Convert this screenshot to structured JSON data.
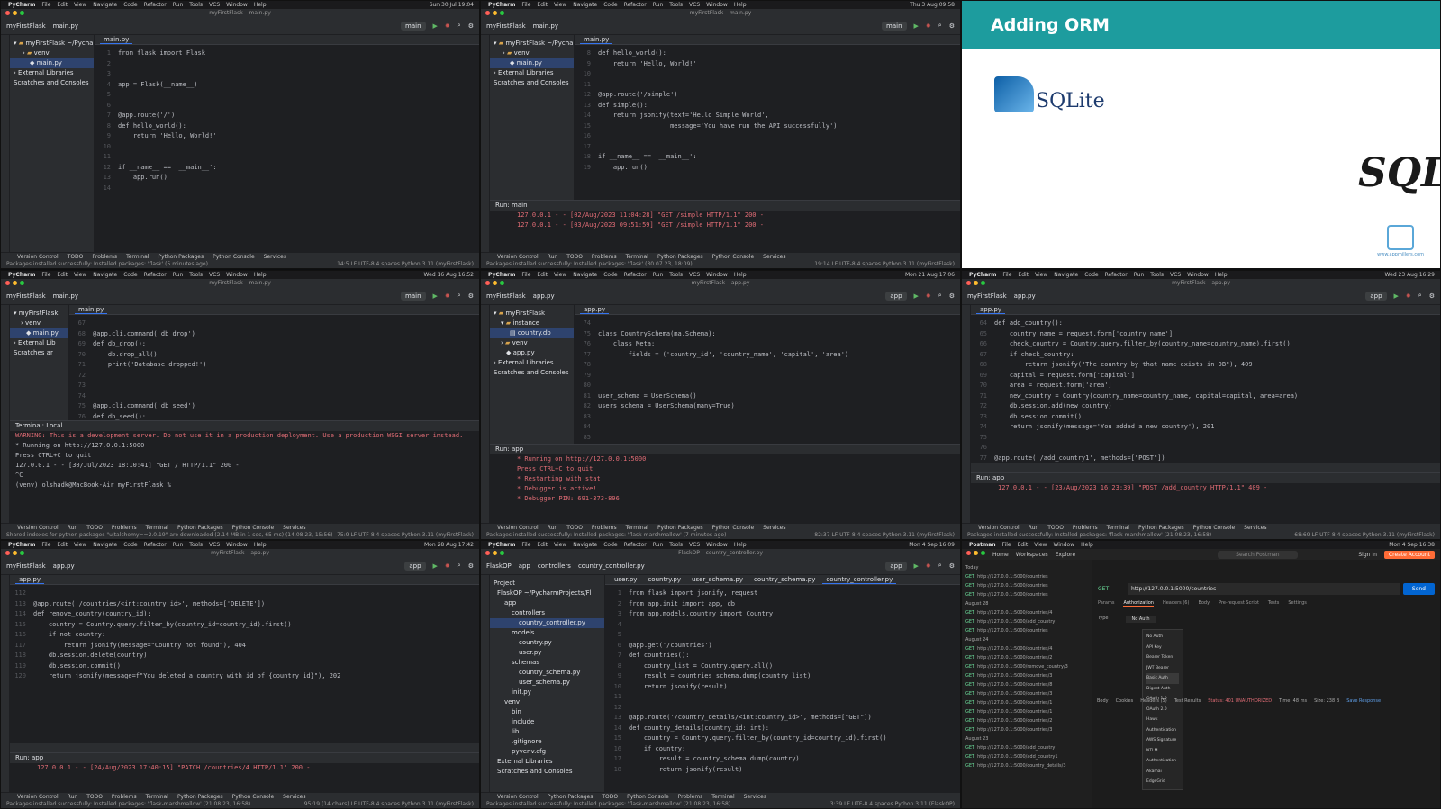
{
  "menubar": [
    "File",
    "Edit",
    "View",
    "Navigate",
    "Code",
    "Refactor",
    "Run",
    "Tools",
    "VCS",
    "Window",
    "Help"
  ],
  "panes": {
    "p1": {
      "app": "PyCharm",
      "clock": "Sun 30 Jul 19:04",
      "window_title": "myFirstFlask – main.py",
      "project": "myFirstFlask",
      "file": "main.py",
      "branch": "main",
      "tree": [
        "myFirstFlask ~/PycharmProjects",
        "venv",
        "main.py",
        "External Libraries",
        "Scratches and Consoles"
      ],
      "code": [
        {
          "n": "1",
          "t": "from flask import Flask"
        },
        {
          "n": "2",
          "t": ""
        },
        {
          "n": "3",
          "t": ""
        },
        {
          "n": "4",
          "t": "app = Flask(__name__)"
        },
        {
          "n": "5",
          "t": ""
        },
        {
          "n": "6",
          "t": ""
        },
        {
          "n": "7",
          "t": "@app.route('/')"
        },
        {
          "n": "8",
          "t": "def hello_world():"
        },
        {
          "n": "9",
          "t": "    return 'Hello, World!'"
        },
        {
          "n": "10",
          "t": ""
        },
        {
          "n": "11",
          "t": ""
        },
        {
          "n": "12",
          "t": "if __name__ == '__main__':"
        },
        {
          "n": "13",
          "t": "    app.run()"
        },
        {
          "n": "14",
          "t": "    "
        }
      ],
      "tools": [
        "Version Control",
        "TODO",
        "Problems",
        "Terminal",
        "Python Packages",
        "Python Console",
        "Services"
      ],
      "status": "Packages installed successfully: Installed packages: 'flask' (5 minutes ago)",
      "status_r": "14:5  LF  UTF-8  4 spaces  Python 3.11 (myFirstFlask)"
    },
    "p2": {
      "app": "PyCharm",
      "clock": "Thu 3 Aug 09:58",
      "window_title": "myFirstFlask – main.py",
      "project": "myFirstFlask",
      "file": "main.py",
      "branch": "main",
      "tree": [
        "myFirstFlask ~/PycharmProjects",
        "venv",
        "main.py",
        "External Libraries",
        "Scratches and Consoles"
      ],
      "code": [
        {
          "n": "8",
          "t": "def hello_world():"
        },
        {
          "n": "9",
          "t": "    return 'Hello, World!'"
        },
        {
          "n": "10",
          "t": ""
        },
        {
          "n": "11",
          "t": ""
        },
        {
          "n": "12",
          "t": "@app.route('/simple')"
        },
        {
          "n": "13",
          "t": "def simple():"
        },
        {
          "n": "14",
          "t": "    return jsonify(text='Hello Simple World',"
        },
        {
          "n": "15",
          "t": "                   message='You have run the API successfully')"
        },
        {
          "n": "16",
          "t": ""
        },
        {
          "n": "17",
          "t": ""
        },
        {
          "n": "18",
          "t": "if __name__ == '__main__':"
        },
        {
          "n": "19",
          "t": "    app.run()"
        }
      ],
      "crumb": "if __name__ == '__main__'",
      "run_label": "Run:",
      "run_tab": "main",
      "run_lines": [
        "127.0.0.1 - - [02/Aug/2023 11:04:28] \"GET /simple HTTP/1.1\" 200 -",
        "127.0.0.1 - - [03/Aug/2023 09:51:59] \"GET /simple HTTP/1.1\" 200 -"
      ],
      "tools": [
        "Version Control",
        "Run",
        "TODO",
        "Problems",
        "Terminal",
        "Python Packages",
        "Python Console",
        "Services"
      ],
      "status": "Packages installed successfully: Installed packages: 'flask' (30.07.23, 18:09)",
      "status_r": "19:14  LF  UTF-8  4 spaces  Python 3.11 (myFirstFlask)"
    },
    "p3": {
      "title": "Adding ORM",
      "logo_text": "SQLite",
      "big_text": "SQL",
      "footer": "www.appmillers.com"
    },
    "p4": {
      "app": "PyCharm",
      "clock": "Wed 16 Aug 16:52",
      "window_title": "myFirstFlask – main.py",
      "project": "myFirstFlask",
      "file": "main.py",
      "branch": "main",
      "tree": [
        "myFirstFlask",
        "venv",
        "main.py",
        "External Lib",
        "Scratches ar"
      ],
      "code": [
        {
          "n": "67",
          "t": ""
        },
        {
          "n": "68",
          "t": "@app.cli.command('db_drop')"
        },
        {
          "n": "69",
          "t": "def db_drop():"
        },
        {
          "n": "70",
          "t": "    db.drop_all()"
        },
        {
          "n": "71",
          "t": "    print('Database dropped!')"
        },
        {
          "n": "72",
          "t": ""
        },
        {
          "n": "73",
          "t": ""
        },
        {
          "n": "74",
          "t": ""
        },
        {
          "n": "75",
          "t": "@app.cli.command('db_seed')"
        },
        {
          "n": "76",
          "t": "def db_seed():"
        }
      ],
      "crumb": "db_seed()",
      "term_label": "Terminal:",
      "term_tab": "Local",
      "term_lines": [
        "WARNING: This is a development server. Do not use it in a production deployment. Use a production WSGI server instead.",
        "* Running on http://127.0.0.1:5000",
        "Press CTRL+C to quit",
        "127.0.0.1 - - [30/Jul/2023 18:10:41] \"GET / HTTP/1.1\" 200 -",
        "^C",
        "(venv) olshadk@MacBook-Air myFirstFlask % "
      ],
      "tools": [
        "Version Control",
        "Run",
        "TODO",
        "Problems",
        "Terminal",
        "Python Packages",
        "Python Console",
        "Services"
      ],
      "status": "Shared indexes for python packages \"ujtalchemy==2.0.19\" are downloaded (2.14 MB in 1 sec, 65 ms) (14.08.23, 15:56)",
      "status_r": "75:9  LF  UTF-8  4 spaces  Python 3.11 (myFirstFlask)"
    },
    "p5": {
      "app": "PyCharm",
      "clock": "Mon 21 Aug 17:06",
      "window_title": "myFirstFlask – app.py",
      "project": "myFirstFlask",
      "file": "app.py",
      "branch": "app",
      "tree": [
        "myFirstFlask",
        "instance",
        "country.db",
        "venv",
        "app.py",
        "External Libraries",
        "Scratches and Consoles"
      ],
      "code": [
        {
          "n": "74",
          "t": ""
        },
        {
          "n": "75",
          "t": "class CountrySchema(ma.Schema):"
        },
        {
          "n": "76",
          "t": "    class Meta:"
        },
        {
          "n": "77",
          "t": "        fields = ('country_id', 'country_name', 'capital', 'area')"
        },
        {
          "n": "78",
          "t": ""
        },
        {
          "n": "79",
          "t": ""
        },
        {
          "n": "80",
          "t": ""
        },
        {
          "n": "81",
          "t": "user_schema = UserSchema()"
        },
        {
          "n": "82",
          "t": "users_schema = UserSchema(many=True)"
        },
        {
          "n": "83",
          "t": ""
        },
        {
          "n": "84",
          "t": ""
        },
        {
          "n": "85",
          "t": ""
        },
        {
          "n": "86",
          "t": "@app.cli.command('db_create')"
        }
      ],
      "run_label": "Run:",
      "run_tab": "app",
      "run_lines": [
        "* Running on http://127.0.0.1:5000",
        "Press CTRL+C to quit",
        "* Restarting with stat",
        "* Debugger is active!",
        "* Debugger PIN: 691-373-896"
      ],
      "tools": [
        "Version Control",
        "Run",
        "TODO",
        "Problems",
        "Terminal",
        "Python Packages",
        "Python Console",
        "Services"
      ],
      "status": "Packages installed successfully: Installed packages: 'flask-marshmallow' (7 minutes ago)",
      "status_r": "82:37  LF  UTF-8  4 spaces  Python 3.11 (myFirstFlask)"
    },
    "p6": {
      "app": "PyCharm",
      "clock": "Wed 23 Aug 16:29",
      "window_title": "myFirstFlask – app.py",
      "project": "myFirstFlask",
      "file": "app.py",
      "branch": "app",
      "code": [
        {
          "n": "64",
          "t": "def add_country():"
        },
        {
          "n": "65",
          "t": "    country_name = request.form['country_name']"
        },
        {
          "n": "66",
          "t": "    check_country = Country.query.filter_by(country_name=country_name).first()"
        },
        {
          "n": "67",
          "t": "    if check_country:"
        },
        {
          "n": "68",
          "t": "        return jsonify(\"The country by that name exists in DB\"), 409"
        },
        {
          "n": "69",
          "t": "    capital = request.form['capital']"
        },
        {
          "n": "70",
          "t": "    area = request.form['area']"
        },
        {
          "n": "71",
          "t": "    new_country = Country(country_name=country_name, capital=capital, area=area)"
        },
        {
          "n": "72",
          "t": "    db.session.add(new_country)"
        },
        {
          "n": "73",
          "t": "    db.session.commit()"
        },
        {
          "n": "74",
          "t": "    return jsonify(message='You added a new country'), 201"
        },
        {
          "n": "75",
          "t": ""
        },
        {
          "n": "76",
          "t": ""
        },
        {
          "n": "77",
          "t": "@app.route('/add_country1', methods=[\"POST\"])"
        }
      ],
      "crumb": "add_country()  ›  if check_country",
      "run_label": "Run:",
      "run_tab": "app",
      "run_lines": [
        "127.0.0.1 - - [23/Aug/2023 16:23:39] \"POST /add_country HTTP/1.1\" 409 -"
      ],
      "tools": [
        "Version Control",
        "Run",
        "TODO",
        "Problems",
        "Terminal",
        "Python Packages",
        "Python Console",
        "Services"
      ],
      "status": "Packages installed successfully: Installed packages: 'flask-marshmallow' (21.08.23, 16:58)",
      "status_r": "68:69  LF  UTF-8  4 spaces  Python 3.11 (myFirstFlask)"
    },
    "p7": {
      "app": "PyCharm",
      "clock": "Mon 28 Aug 17:42",
      "window_title": "myFirstFlask – app.py",
      "project": "myFirstFlask",
      "file": "app.py",
      "branch": "app",
      "code": [
        {
          "n": "112",
          "t": ""
        },
        {
          "n": "113",
          "t": "@app.route('/countries/<int:country_id>', methods=['DELETE'])"
        },
        {
          "n": "114",
          "t": "def remove_country(country_id):"
        },
        {
          "n": "115",
          "t": "    country = Country.query.filter_by(country_id=country_id).first()"
        },
        {
          "n": "116",
          "t": "    if not country:"
        },
        {
          "n": "117",
          "t": "        return jsonify(message=\"Country not found\"), 404"
        },
        {
          "n": "118",
          "t": "    db.session.delete(country)"
        },
        {
          "n": "119",
          "t": "    db.session.commit()"
        },
        {
          "n": "120",
          "t": "    return jsonify(message=f\"You deleted a country with id of {country_id}\"), 202"
        }
      ],
      "crumb": "update_country()",
      "run_label": "Run:",
      "run_tab": "app",
      "run_lines": [
        "127.0.0.1 - - [24/Aug/2023 17:40:15] \"PATCH /countries/4 HTTP/1.1\" 200 -"
      ],
      "tools": [
        "Version Control",
        "Run",
        "TODO",
        "Problems",
        "Terminal",
        "Python Packages",
        "Python Console",
        "Services"
      ],
      "status": "Packages installed successfully: Installed packages: 'flask-marshmallow' (21.08.23, 16:58)",
      "status_r": "95:19 (14 chars)  LF  UTF-8  4 spaces  Python 3.11 (myFirstFlask)"
    },
    "p8": {
      "app": "PyCharm",
      "clock": "Mon 4 Sep 16:09",
      "window_title": "FlaskOP – country_controller.py",
      "project": "FlaskOP",
      "crumbs": [
        "app",
        "controllers",
        "country_controller.py"
      ],
      "branch": "app",
      "tabs": [
        "user.py",
        "country.py",
        "user_schema.py",
        "country_schema.py",
        "country_controller.py"
      ],
      "tree": [
        "Project",
        "FlaskOP ~/PycharmProjects/Fl",
        "app",
        "controllers",
        "country_controller.py",
        "models",
        "country.py",
        "user.py",
        "schemas",
        "country_schema.py",
        "user_schema.py",
        "init.py",
        "venv",
        "bin",
        "include",
        "lib",
        ".gitignore",
        "pyvenv.cfg",
        "External Libraries",
        "Scratches and Consoles"
      ],
      "code": [
        {
          "n": "1",
          "t": "from flask import jsonify, request"
        },
        {
          "n": "2",
          "t": "from app.init import app, db"
        },
        {
          "n": "3",
          "t": "from app.models.country import Country"
        },
        {
          "n": "4",
          "t": ""
        },
        {
          "n": "5",
          "t": ""
        },
        {
          "n": "6",
          "t": "@app.get('/countries')"
        },
        {
          "n": "7",
          "t": "def countries():"
        },
        {
          "n": "8",
          "t": "    country_list = Country.query.all()"
        },
        {
          "n": "9",
          "t": "    result = countries_schema.dump(country_list)"
        },
        {
          "n": "10",
          "t": "    return jsonify(result)"
        },
        {
          "n": "11",
          "t": ""
        },
        {
          "n": "12",
          "t": ""
        },
        {
          "n": "13",
          "t": "@app.route('/country_details/<int:country_id>', methods=[\"GET\"])"
        },
        {
          "n": "14",
          "t": "def country_details(country_id: int):"
        },
        {
          "n": "15",
          "t": "    country = Country.query.filter_by(country_id=country_id).first()"
        },
        {
          "n": "16",
          "t": "    if country:"
        },
        {
          "n": "17",
          "t": "        result = country_schema.dump(country)"
        },
        {
          "n": "18",
          "t": "        return jsonify(result)"
        }
      ],
      "tools": [
        "Version Control",
        "Python Packages",
        "TODO",
        "Python Console",
        "Problems",
        "Terminal",
        "Services"
      ],
      "status": "Packages installed successfully: Installed packages: 'flask-marshmallow' (21.08.23, 16:58)",
      "status_r": "3:39  LF  UTF-8  4 spaces  Python 3.11 (FlaskOP)"
    },
    "p9": {
      "app": "Postman",
      "clock": "Mon 4 Sep 16:38",
      "nav": [
        "Home",
        "Workspaces",
        "Explore"
      ],
      "search": "Search Postman",
      "signin": "Sign In",
      "create": "Create Account",
      "history": [
        "Today",
        "http://127.0.0.1:5000/countries",
        "http://127.0.0.1:5000/countries",
        "http://127.0.0.1:5000/countries",
        "August 28",
        "http://127.0.0.1:5000/countries/4",
        "http://127.0.0.1:5000/add_country",
        "http://127.0.0.1:5000/countries",
        "August 24",
        "http://127.0.0.1:5000/countries/4",
        "http://127.0.0.1:5000/countries/2",
        "http://127.0.0.1:5000/remove_country/3",
        "http://127.0.0.1:5000/countries/3",
        "http://127.0.0.1:5000/countries/8",
        "http://127.0.0.1:5000/countries/3",
        "http://127.0.0.1:5000/countries/1",
        "http://127.0.0.1:5000/countries/1",
        "http://127.0.0.1:5000/countries/2",
        "http://127.0.0.1:5000/countries/3",
        "August 23",
        "http://127.0.0.1:5000/add_country",
        "http://127.0.0.1:5000/add_country1",
        "http://127.0.0.1:5000/country_details/3"
      ],
      "request_url": "http://127.0.0.1:5000/countries",
      "method": "GET",
      "send": "Send",
      "subtabs": [
        "Params",
        "Authorization",
        "Headers (6)",
        "Body",
        "Pre-request Script",
        "Tests",
        "Settings"
      ],
      "auth_type_label": "Type",
      "auth_type": "No Auth",
      "auth_options": [
        "No Auth",
        "API Key",
        "Bearer Token",
        "JWT Bearer",
        "Basic Auth",
        "Digest Auth",
        "OAuth 1.0",
        "OAuth 2.0",
        "Hawk Authentication",
        "AWS Signature",
        "NTLM Authentication",
        "Akamai EdgeGrid"
      ],
      "resp_tabs": [
        "Body",
        "Cookies",
        "Headers (5)",
        "Test Results"
      ],
      "resp_status": "Status: 401 UNAUTHORIZED",
      "resp_time": "Time: 48 ms",
      "resp_size": "Size: 238 B",
      "save": "Save Response"
    }
  }
}
